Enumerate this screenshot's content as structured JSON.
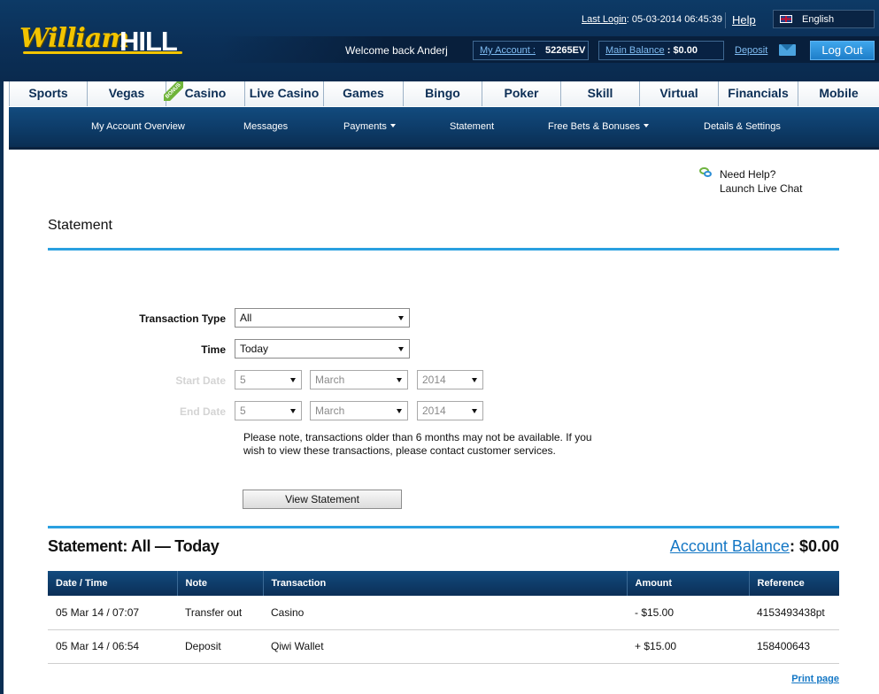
{
  "brand": {
    "script": "William",
    "hill": "HILL",
    "accent": "#f3c400",
    "navy": "#0b2f57",
    "link_blue": "#1477c5"
  },
  "header": {
    "last_login_label": "Last Login",
    "last_login_value": ": 05-03-2014 06:45:39",
    "help": "Help",
    "language": "English",
    "welcome": "Welcome back  Anderj",
    "my_account_label": "My Account :",
    "my_account_value": "52265EV",
    "main_balance_label": "Main Balance",
    "main_balance_value": ": $0.00",
    "deposit": "Deposit",
    "logout": "Log Out"
  },
  "nav": {
    "tabs": [
      "Sports",
      "Vegas",
      "Casino",
      "Live Casino",
      "Games",
      "Bingo",
      "Poker",
      "Skill",
      "Virtual",
      "Financials",
      "Mobile"
    ],
    "bonus_ribbon": "BONUS"
  },
  "subnav": {
    "items": [
      "My Account Overview",
      "Messages",
      "Payments",
      "Statement",
      "Free Bets & Bonuses",
      "Details & Settings"
    ]
  },
  "help_chat": {
    "line1": "Need Help?",
    "line2": "Launch Live Chat"
  },
  "page_title": "Statement",
  "form": {
    "transaction_type_label": "Transaction Type",
    "transaction_type_value": "All",
    "time_label": "Time",
    "time_value": "Today",
    "start_date_label": "Start Date",
    "end_date_label": "End Date",
    "start_day": "5",
    "start_month": "March",
    "start_year": "2014",
    "end_day": "5",
    "end_month": "March",
    "end_year": "2014",
    "note": "Please note, transactions older than 6 months may not be available. If you wish to view these transactions, please contact customer services.",
    "view_button": "View Statement"
  },
  "statement": {
    "heading": "Statement: All — Today",
    "account_balance_label": "Account Balance",
    "account_balance_value": ":  $0.00",
    "columns": [
      "Date  /  Time",
      "Note",
      "Transaction",
      "Amount",
      "Reference"
    ],
    "rows": [
      [
        "05 Mar 14 / 07:07",
        "Transfer out",
        "Casino",
        "- $15.00",
        "4153493438pt"
      ],
      [
        "05 Mar 14 / 06:54",
        "Deposit",
        "Qiwi Wallet",
        "+ $15.00",
        "158400643"
      ]
    ],
    "print_page": "Print page"
  }
}
